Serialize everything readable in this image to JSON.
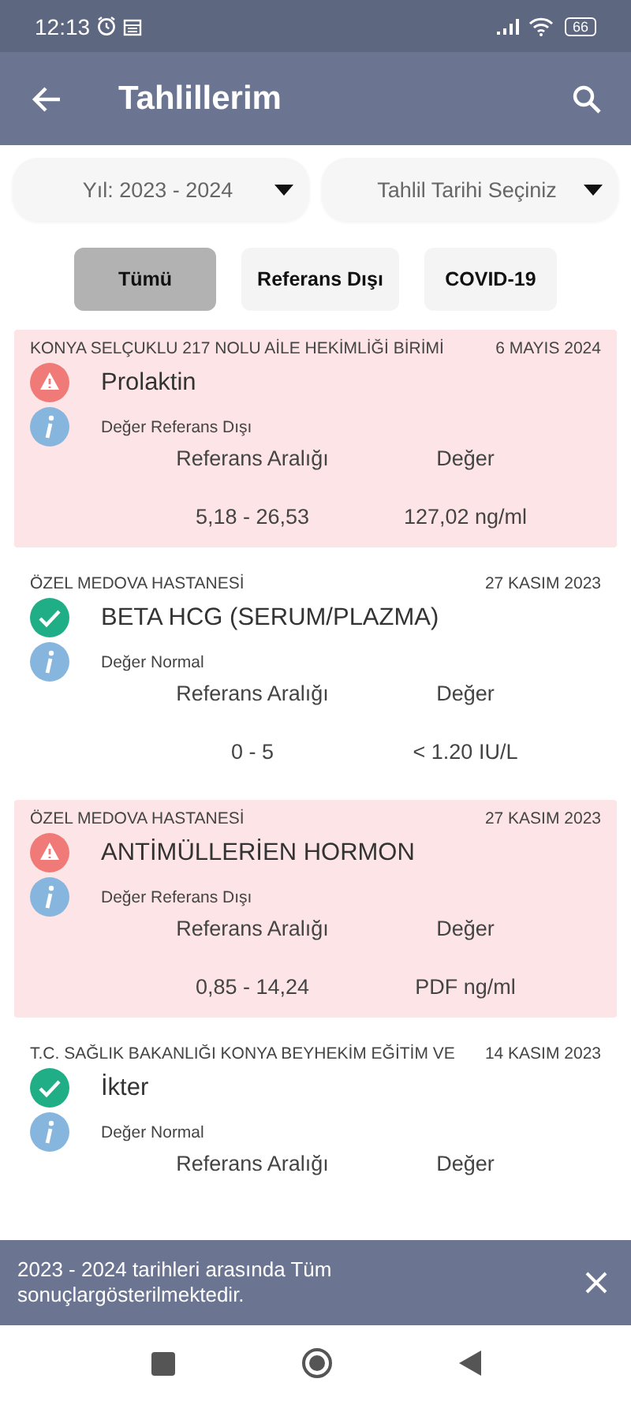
{
  "status_bar": {
    "time": "12:13",
    "battery": "66"
  },
  "app_bar": {
    "title": "Tahlillerim"
  },
  "filters": [
    {
      "value": "Yıl: 2023 - 2024"
    },
    {
      "value": "Tahlil Tarihi Seçiniz"
    }
  ],
  "tabs": [
    {
      "label": "Tümü",
      "selected": true
    },
    {
      "label": "Referans Dışı",
      "selected": false
    },
    {
      "label": "COVID-19",
      "selected": false
    }
  ],
  "results": [
    {
      "institution": "KONYA SELÇUKLU 217 NOLU AİLE HEKİMLİĞİ BİRİMİ",
      "date": "6 MAYIS 2024",
      "kind": "abnormal",
      "name": "Prolaktin",
      "status_text": "Değer Referans Dışı",
      "range_label": "Referans Aralığı",
      "value_label": "Değer",
      "range": "5,18 - 26,53",
      "value": "127,02 ng/ml"
    },
    {
      "institution": "ÖZEL MEDOVA HASTANESİ",
      "date": "27 KASIM 2023",
      "kind": "normal",
      "name": "BETA HCG (SERUM/PLAZMA)",
      "status_text": "Değer Normal",
      "range_label": "Referans Aralığı",
      "value_label": "Değer",
      "range": "0 - 5",
      "value": "< 1.20 IU/L"
    },
    {
      "institution": "ÖZEL MEDOVA HASTANESİ",
      "date": "27 KASIM 2023",
      "kind": "abnormal",
      "name": "ANTİMÜLLERİEN HORMON",
      "status_text": "Değer Referans Dışı",
      "range_label": "Referans Aralığı",
      "value_label": "Değer",
      "range": "0,85 - 14,24",
      "value": "PDF ng/ml"
    },
    {
      "institution": "T.C. SAĞLIK BAKANLIĞI KONYA BEYHEKİM EĞİTİM VE",
      "date": "14 KASIM 2023",
      "kind": "normal",
      "name": "İkter",
      "status_text": "Değer Normal",
      "range_label": "Referans Aralığı",
      "value_label": "Değer"
    }
  ],
  "snackbar": {
    "message": "2023 - 2024 tarihleri arasında Tüm sonuçlargösterilmektedir."
  }
}
